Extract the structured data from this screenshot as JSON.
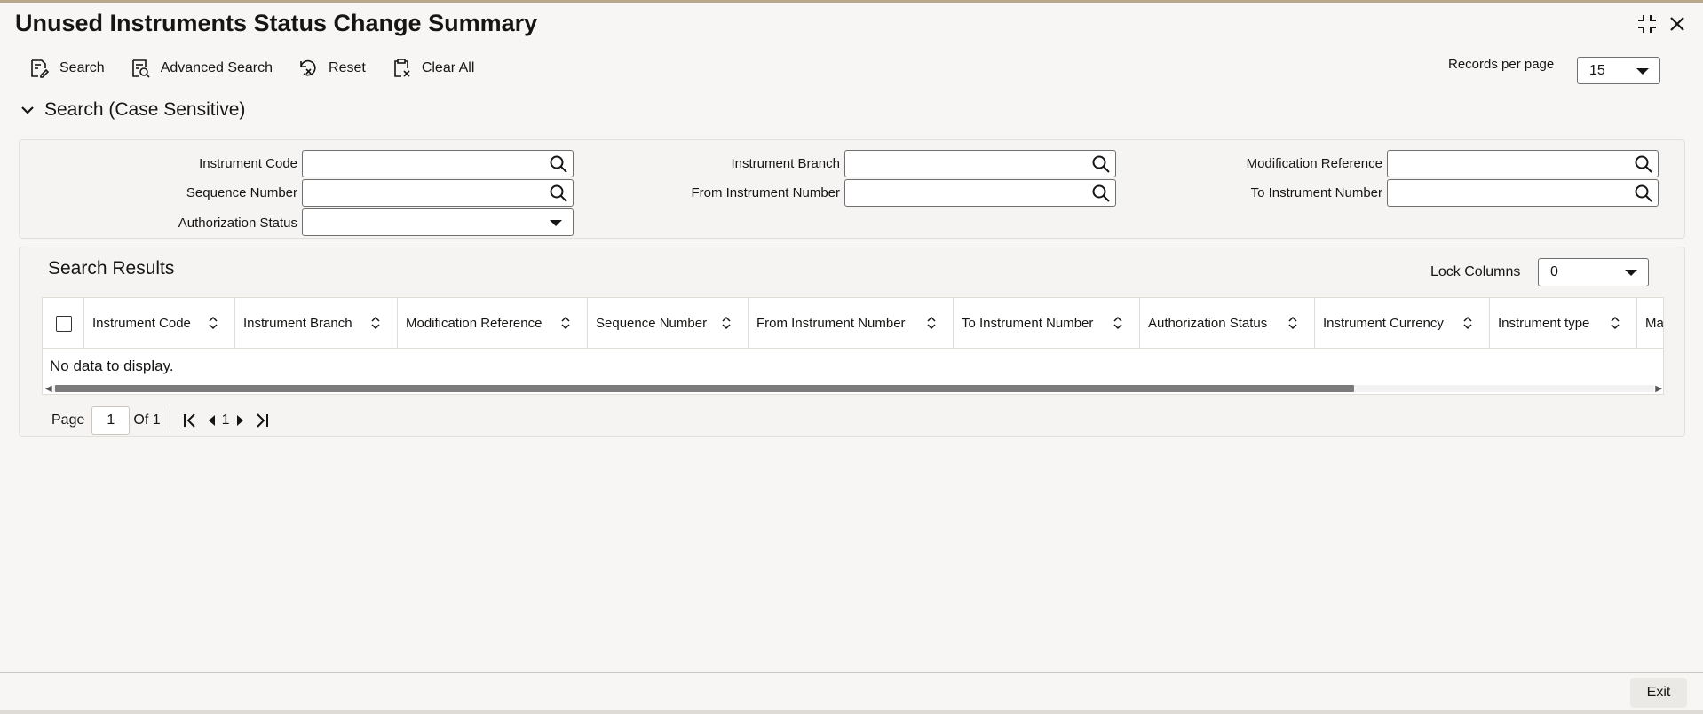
{
  "window": {
    "title": "Unused Instruments Status Change Summary",
    "restore_icon": "collapse-icon",
    "close_icon": "close-icon"
  },
  "toolbar": {
    "search_label": "Search",
    "advanced_search_label": "Advanced Search",
    "reset_label": "Reset",
    "clear_all_label": "Clear All"
  },
  "records_per_page": {
    "label": "Records per page",
    "value": "15"
  },
  "search_section": {
    "title": "Search (Case Sensitive)",
    "fields": {
      "instrument_code": {
        "label": "Instrument Code",
        "value": ""
      },
      "instrument_branch": {
        "label": "Instrument Branch",
        "value": ""
      },
      "modification_reference": {
        "label": "Modification Reference",
        "value": ""
      },
      "sequence_number": {
        "label": "Sequence Number",
        "value": ""
      },
      "from_instrument_number": {
        "label": "From Instrument Number",
        "value": ""
      },
      "to_instrument_number": {
        "label": "To Instrument Number",
        "value": ""
      },
      "authorization_status": {
        "label": "Authorization Status",
        "value": ""
      }
    }
  },
  "results": {
    "title": "Search Results",
    "lock_columns_label": "Lock Columns",
    "lock_columns_value": "0",
    "columns": [
      "Instrument Code",
      "Instrument Branch",
      "Modification Reference",
      "Sequence Number",
      "From Instrument Number",
      "To Instrument Number",
      "Authorization Status",
      "Instrument Currency",
      "Instrument type",
      "Ma"
    ],
    "empty_message": "No data to display."
  },
  "pagination": {
    "page_label": "Page",
    "current_page": "1",
    "of_label": "Of 1",
    "page_link": "1"
  },
  "footer": {
    "exit_label": "Exit"
  },
  "colors": {
    "text": "#161513",
    "background": "#f7f6f4",
    "panel": "#f5f4f2",
    "scroll_thumb": "#7b7b7b"
  }
}
